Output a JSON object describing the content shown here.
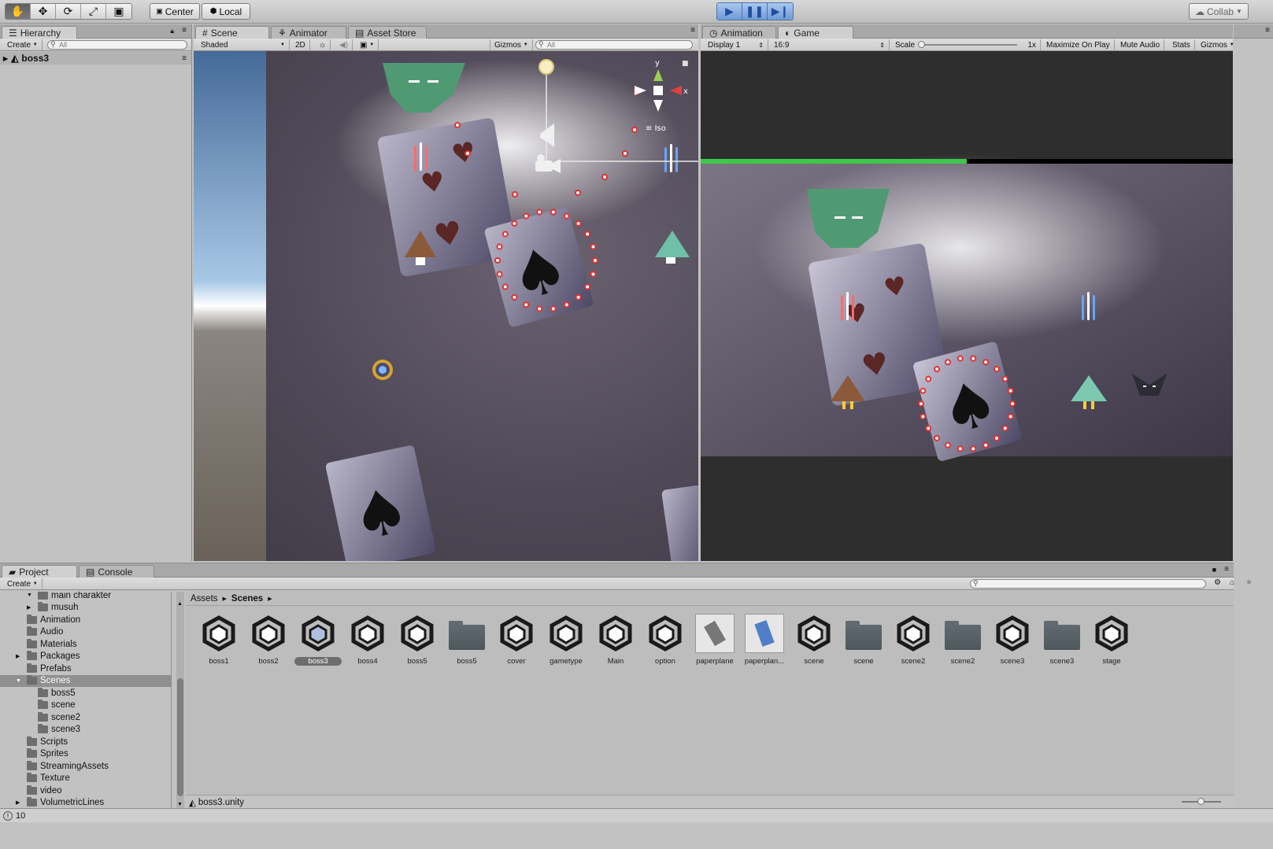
{
  "toolbar": {
    "tools": [
      "hand-tool",
      "move-tool",
      "rotate-tool",
      "scale-tool",
      "rect-tool"
    ],
    "pivot_label": "Center",
    "space_label": "Local",
    "collab_label": "Collab"
  },
  "hierarchy": {
    "tab_label": "Hierarchy",
    "create_label": "Create",
    "search_placeholder": "All",
    "scene_name": "boss3"
  },
  "scene_panel": {
    "tabs": [
      "Scene",
      "Animator",
      "Asset Store"
    ],
    "shading_label": "Shaded",
    "mode_2d_label": "2D",
    "gizmos_label": "Gizmos",
    "search_placeholder": "All",
    "gizmo_y": "y",
    "gizmo_x": "x",
    "projection_label": "Iso"
  },
  "game_panel": {
    "tabs": [
      "Animation",
      "Game"
    ],
    "display_label": "Display 1",
    "aspect_label": "16:9",
    "scale_label": "Scale",
    "scale_value": "1x",
    "maximize_label": "Maximize On Play",
    "mute_label": "Mute Audio",
    "stats_label": "Stats",
    "gizmos_label": "Gizmos",
    "boss_health_fraction": 0.5
  },
  "project": {
    "tabs": [
      "Project",
      "Console"
    ],
    "create_label": "Create",
    "tree": [
      {
        "label": "main charakter",
        "indent": 2,
        "arrow": "▼"
      },
      {
        "label": "musuh",
        "indent": 2,
        "arrow": "▶"
      },
      {
        "label": "Animation",
        "indent": 1,
        "arrow": ""
      },
      {
        "label": "Audio",
        "indent": 1,
        "arrow": ""
      },
      {
        "label": "Materials",
        "indent": 1,
        "arrow": ""
      },
      {
        "label": "Packages",
        "indent": 1,
        "arrow": "▶"
      },
      {
        "label": "Prefabs",
        "indent": 1,
        "arrow": ""
      },
      {
        "label": "Scenes",
        "indent": 1,
        "arrow": "▼",
        "selected": true
      },
      {
        "label": "boss5",
        "indent": 2,
        "arrow": ""
      },
      {
        "label": "scene",
        "indent": 2,
        "arrow": ""
      },
      {
        "label": "scene2",
        "indent": 2,
        "arrow": ""
      },
      {
        "label": "scene3",
        "indent": 2,
        "arrow": ""
      },
      {
        "label": "Scripts",
        "indent": 1,
        "arrow": ""
      },
      {
        "label": "Sprites",
        "indent": 1,
        "arrow": ""
      },
      {
        "label": "StreamingAssets",
        "indent": 1,
        "arrow": ""
      },
      {
        "label": "Texture",
        "indent": 1,
        "arrow": ""
      },
      {
        "label": "video",
        "indent": 1,
        "arrow": ""
      },
      {
        "label": "VolumetricLines",
        "indent": 1,
        "arrow": "▶"
      }
    ],
    "breadcrumb": [
      "Assets",
      "Scenes"
    ],
    "assets": [
      {
        "label": "boss1",
        "kind": "unity"
      },
      {
        "label": "boss2",
        "kind": "unity"
      },
      {
        "label": "boss3",
        "kind": "unity",
        "selected": true
      },
      {
        "label": "boss4",
        "kind": "unity"
      },
      {
        "label": "boss5",
        "kind": "unity"
      },
      {
        "label": "boss5",
        "kind": "folder"
      },
      {
        "label": "cover",
        "kind": "unity"
      },
      {
        "label": "gametype",
        "kind": "unity"
      },
      {
        "label": "Main",
        "kind": "unity"
      },
      {
        "label": "option",
        "kind": "unity"
      },
      {
        "label": "paperplane",
        "kind": "image"
      },
      {
        "label": "paperplan...",
        "kind": "image2"
      },
      {
        "label": "scene",
        "kind": "unity"
      },
      {
        "label": "scene",
        "kind": "folder"
      },
      {
        "label": "scene2",
        "kind": "unity"
      },
      {
        "label": "scene2",
        "kind": "folder"
      },
      {
        "label": "scene3",
        "kind": "unity"
      },
      {
        "label": "scene3",
        "kind": "folder"
      },
      {
        "label": "stage",
        "kind": "unity"
      }
    ],
    "selected_file": "boss3.unity"
  },
  "status": {
    "count": "10"
  }
}
